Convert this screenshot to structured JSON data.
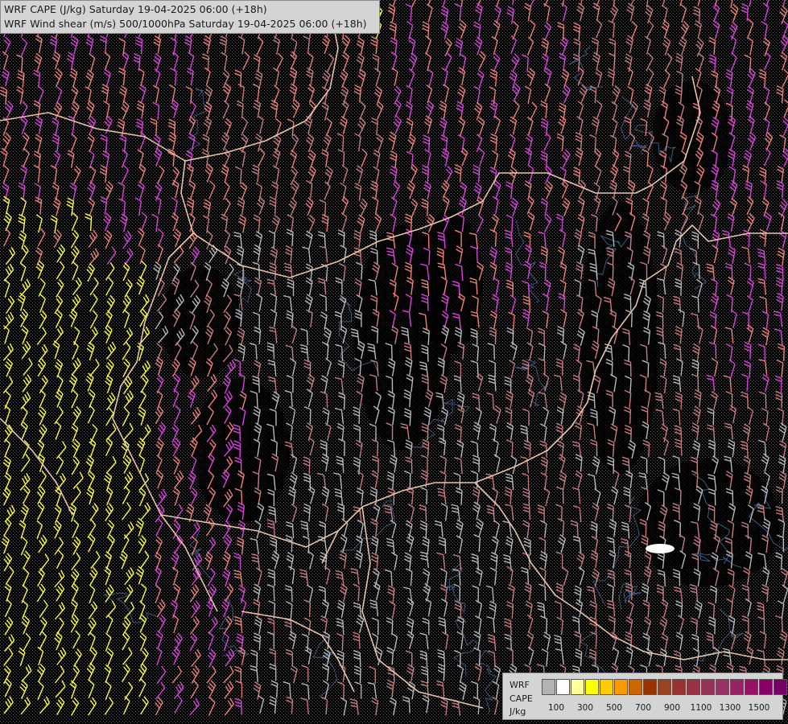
{
  "header": {
    "line1": "WRF CAPE (J/kg) Saturday 19-04-2025 06:00 (+18h)",
    "line2": "WRF Wind shear (m/s) 500/1000hPa Saturday 19-04-2025 06:00 (+18h)"
  },
  "legend": {
    "title1": "WRF",
    "title2": "CAPE",
    "title3": "J/kg",
    "tick_labels": [
      "100",
      "300",
      "500",
      "700",
      "900",
      "1100",
      "1300",
      "1500"
    ],
    "colors": [
      "#b3b3b3",
      "#ffffff",
      "#ffff99",
      "#ffff00",
      "#ffcc00",
      "#ff9900",
      "#cc6600",
      "#993300",
      "#994422",
      "#993333",
      "#993344",
      "#993355",
      "#993366",
      "#992266",
      "#991166",
      "#880066",
      "#770066"
    ]
  },
  "map": {
    "background_color": "#000000",
    "border_color": "#e8c4a8",
    "river_color": "#3c5a82",
    "barb_colors": [
      "#b8b8b8",
      "#c97c80",
      "#f08078",
      "#e040e0",
      "#ffff33"
    ]
  }
}
